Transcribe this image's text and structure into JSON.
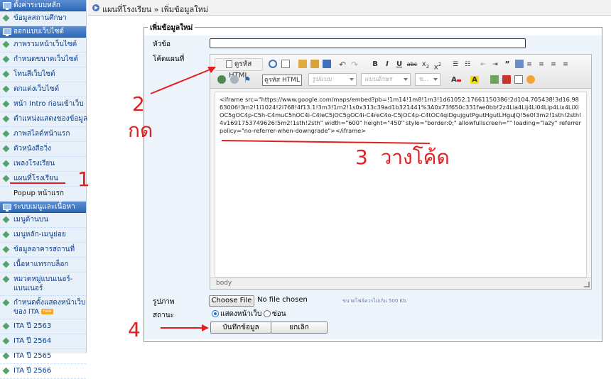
{
  "sidebar": {
    "sections": [
      {
        "title": "ตั้งค่าระบบหลัก",
        "items": [
          "ข้อมูลสถานศึกษา"
        ]
      },
      {
        "title": "ออกแบบเว็บไซต์",
        "items": [
          "ภาพรวมหน้าเว็บไซต์",
          "กำหนดขนาดเว็บไซต์",
          "โทนสีเว็บไซต์",
          "ตกแต่งเว็บไซต์",
          "หน้า Intro ก่อนเข้าเว็บ",
          "ตำแหน่งแสดงของข้อมูล",
          "ภาพสไลด์หน้าแรก",
          "ตัวหนังสือวิ่ง",
          "เพลงโรงเรียน",
          "แผนที่โรงเรียน",
          "Popup หน้าแรก"
        ]
      },
      {
        "title": "ระบบเมนูและเนื้อหา",
        "items": [
          "เมนูด้านบน",
          "เมนูหลัก-เมนูย่อย",
          "ข้อมูลอาคารสถานที่",
          "เนื้อหาแทรกบล็อก",
          "หมวดหมู่แบนเนอร์-แบนเนอร์",
          "กำหนดตั้งแสดงหน้าเว็บของ ITA",
          "ITA ปี 2563",
          "ITA ปี 2564",
          "ITA ปี 2565",
          "ITA ปี 2566"
        ]
      }
    ],
    "new_badge": "new"
  },
  "breadcrumb": {
    "parent": "แผนที่โรงเรียน",
    "separator": "»",
    "current": "เพิ่มข้อมูลใหม่"
  },
  "form": {
    "legend": "เพิ่มข้อมูลใหม่",
    "title_label": "หัวข้อ",
    "title_value": "",
    "code_label": "โค้ดแผนที่",
    "image_label": "รูปภาพ",
    "file_button": "Choose File",
    "file_status": "No file chosen",
    "file_note": "ขนาดไฟล์ควรไม่เกิน 500 Kb.",
    "status_label": "สถานะ",
    "radio_show": "แสดงหน้าเว็บ",
    "radio_hide": "ซ่อน",
    "save_button": "บันทึกข้อมูล",
    "cancel_button": "ยกเลิก"
  },
  "editor": {
    "source_button": "ดูรหัส HTML",
    "tooltip": "ดูรหัส HTML",
    "combo_style": "รูปแบบ",
    "combo_font": "แบบอักษร",
    "combo_size": "ข...",
    "content": "<iframe src=\"https://www.google.com/maps/embed?pb=!1m14!1m8!1m3!1d61052.17661150386!2d104.705438!3d16.9863006!3m2!1i1024!2i768!4f13.1!3m3!1m2!1s0x313c39ad1b321441%3A0x73f650c331fae0bb!2z4Lia4Lij4Li04Lip4Lix4LiXIOC5gOC4p-C5h-C4muC5hOC4i-C4leC5jOC5gOC4i-C4reC4o-C5jOC4p-C4tOC4qiDgujgutPgutHgutLHguJQ!5e0!3m2!1sth!2sth!4v1691753749626!5m2!1sth!2sth\" width=\"600\" height=\"450\" style=\"border:0;\" allowfullscreen=\"\" loading=\"lazy\" referrerpolicy=\"no-referrer-when-downgrade\"></iframe>",
    "path": "body"
  },
  "annotations": {
    "step1": "1",
    "step2_num": "2",
    "step2_text": "กด",
    "step3": "3  วางโค้ด",
    "step4": "4"
  },
  "colors": {
    "annotation": "#e02020",
    "sidebar_header": "#2f69b8",
    "link": "#0b3f8c"
  }
}
